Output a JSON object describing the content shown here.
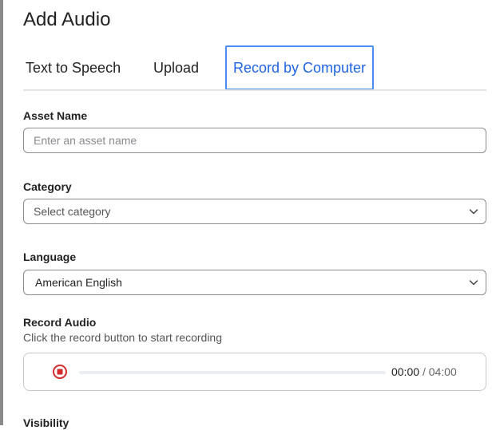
{
  "dialog": {
    "title": "Add Audio"
  },
  "tabs": [
    {
      "label": "Text to Speech",
      "active": false
    },
    {
      "label": "Upload",
      "active": false
    },
    {
      "label": "Record by Computer",
      "active": true
    }
  ],
  "asset_name": {
    "label": "Asset Name",
    "value": "",
    "placeholder": "Enter an asset name"
  },
  "category": {
    "label": "Category",
    "selected": "Select category"
  },
  "language": {
    "label": "Language",
    "selected": "American English"
  },
  "record_audio": {
    "label": "Record Audio",
    "helper": "Click the record button to start recording",
    "current_time": "00:00",
    "separator": "/",
    "total_time": "04:00",
    "progress": 0
  },
  "visibility": {
    "label": "Visibility"
  },
  "colors": {
    "accent": "#1f64e3",
    "record_red": "#d42a2a"
  },
  "icons": {
    "record": "record-stop-icon",
    "dropdown": "chevron-down-icon"
  }
}
